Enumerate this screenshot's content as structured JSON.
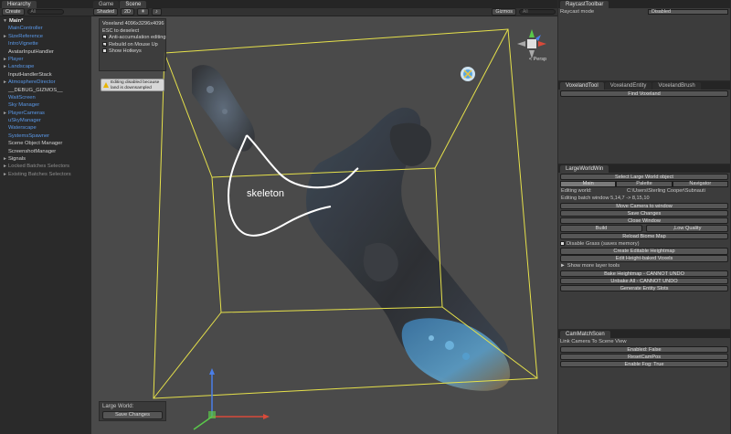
{
  "hierarchy": {
    "tab": "Hierarchy",
    "create_label": "Create",
    "search_placeholder": "All",
    "items": [
      {
        "label": "Main*",
        "kind": "scene",
        "arrow": "▼"
      },
      {
        "label": "MainController",
        "kind": "blue",
        "arrow": ""
      },
      {
        "label": "SizeReference",
        "kind": "blue",
        "arrow": "►"
      },
      {
        "label": "IntroVignette",
        "kind": "blue",
        "arrow": ""
      },
      {
        "label": "AvatarInputHandler",
        "kind": "white",
        "arrow": ""
      },
      {
        "label": "Player",
        "kind": "blue",
        "arrow": "►"
      },
      {
        "label": "Landscape",
        "kind": "blue",
        "arrow": "►"
      },
      {
        "label": "InputHandlerStack",
        "kind": "white",
        "arrow": ""
      },
      {
        "label": "AtmosphereDirector",
        "kind": "blue",
        "arrow": "►"
      },
      {
        "label": "__DEBUG_GIZMOS__",
        "kind": "white",
        "arrow": ""
      },
      {
        "label": "WaitScreen",
        "kind": "blue",
        "arrow": ""
      },
      {
        "label": "Sky Manager",
        "kind": "blue",
        "arrow": ""
      },
      {
        "label": "PlayerCameras",
        "kind": "blue",
        "arrow": "►"
      },
      {
        "label": "uSkyManager",
        "kind": "blue",
        "arrow": ""
      },
      {
        "label": "Waterscape",
        "kind": "blue",
        "arrow": ""
      },
      {
        "label": "SystemsSpawner",
        "kind": "blue",
        "arrow": ""
      },
      {
        "label": "Scene Object Manager",
        "kind": "white",
        "arrow": ""
      },
      {
        "label": "ScreenshotManager",
        "kind": "white",
        "arrow": ""
      },
      {
        "label": "Signals",
        "kind": "white",
        "arrow": "►"
      },
      {
        "label": "Locked Batches Selectors",
        "kind": "grey",
        "arrow": "►"
      },
      {
        "label": "Existing Batches Selectors",
        "kind": "grey",
        "arrow": "►"
      }
    ]
  },
  "scene": {
    "tabs": [
      "Game",
      "Scene"
    ],
    "shading": "Shaded",
    "mode_2d": "2D",
    "gizmos": "Gizmos",
    "search_placeholder": "All",
    "overlay": {
      "title": "Voxeland 4096x3296x4096",
      "esc": "ESC to deselect",
      "anti_accum": "Anti-accumulation editing",
      "rebuild": "Rebuild on Mouse Up",
      "hotkeys": "Show Hotkeys"
    },
    "warning": "Editing disabled because land is downsampled",
    "persp": "< Persp",
    "skeleton_label": "skeleton",
    "large_world_label": "Large World:",
    "save_changes": "Save Changes"
  },
  "inspector": {
    "raycast": {
      "tab": "RaycastToolbar",
      "mode_label": "Raycast mode",
      "mode_value": "Disabled"
    },
    "voxeland_tabs": [
      "VoxelandTool",
      "VoxelandEntity",
      "VoxelandBrush"
    ],
    "find_voxeland": "Find Voxeland",
    "large_world": {
      "tab": "LargeWorldWin",
      "select_btn": "Select Large World object",
      "segments": [
        "Main",
        "Palette",
        "Navigator"
      ],
      "editing_world_label": "Editing world:",
      "editing_world_value": "C:\\Users\\Sterling Cooper\\Subnauti",
      "batch_window": "Editing batch window 5,14,7 -> 8,15,10",
      "move_camera": "Move Camera to window",
      "save_changes": "Save Changes",
      "close_window": "Close Window",
      "build": "Build",
      "low_quality": ",Low Quality",
      "reload_biome": "Reload Biome Map",
      "disable_grass": "Disable Grass (saves memory)",
      "create_heightmap": "Create Editable Heightmap",
      "edit_voxels": "Edit Height-baked Voxels",
      "more_tools": "Show more layer tools",
      "bake_heightmap": "Bake Heightmap - CANNOT UNDO",
      "unbake_all": "Unbake All - CANNOT UNDO",
      "generate_slots": "Generate Entity Slots"
    },
    "cam_match": {
      "tab": "CamMatchScen",
      "link_label": "Link Camera To Scene View",
      "enabled": "Enabled: False",
      "reset": "ResetCamPos",
      "fog": "Enable Fog: True"
    }
  },
  "colors": {
    "blue_item": "#5a98e8",
    "bounds_yellow": "#e6e14a",
    "panel_bg": "#3c3c3c"
  }
}
